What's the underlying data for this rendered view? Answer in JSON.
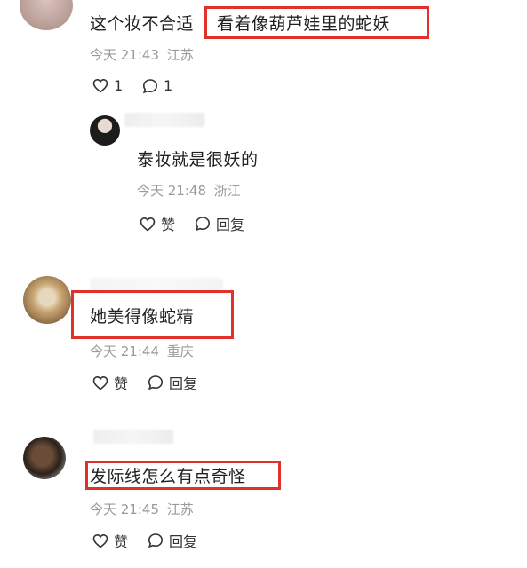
{
  "comments": [
    {
      "text_plain": "这个妆不合适",
      "text_highlight": "看着像葫芦娃里的蛇妖",
      "time": "今天 21:43",
      "location": "江苏",
      "like_count": "1",
      "reply_count": "1"
    },
    {
      "text": "泰妆就是很妖的",
      "time": "今天 21:48",
      "location": "浙江",
      "like_label": "赞",
      "reply_label": "回复"
    },
    {
      "text": "她美得像蛇精",
      "time": "今天 21:44",
      "location": "重庆",
      "like_label": "赞",
      "reply_label": "回复"
    },
    {
      "text": "发际线怎么有点奇怪",
      "time": "今天 21:45",
      "location": "江苏",
      "like_label": "赞",
      "reply_label": "回复"
    }
  ],
  "colors": {
    "highlight_border": "#e0322a",
    "meta_text": "#9a9a9a"
  },
  "icons": {
    "like": "heart-icon",
    "reply": "comment-bubble-icon"
  }
}
